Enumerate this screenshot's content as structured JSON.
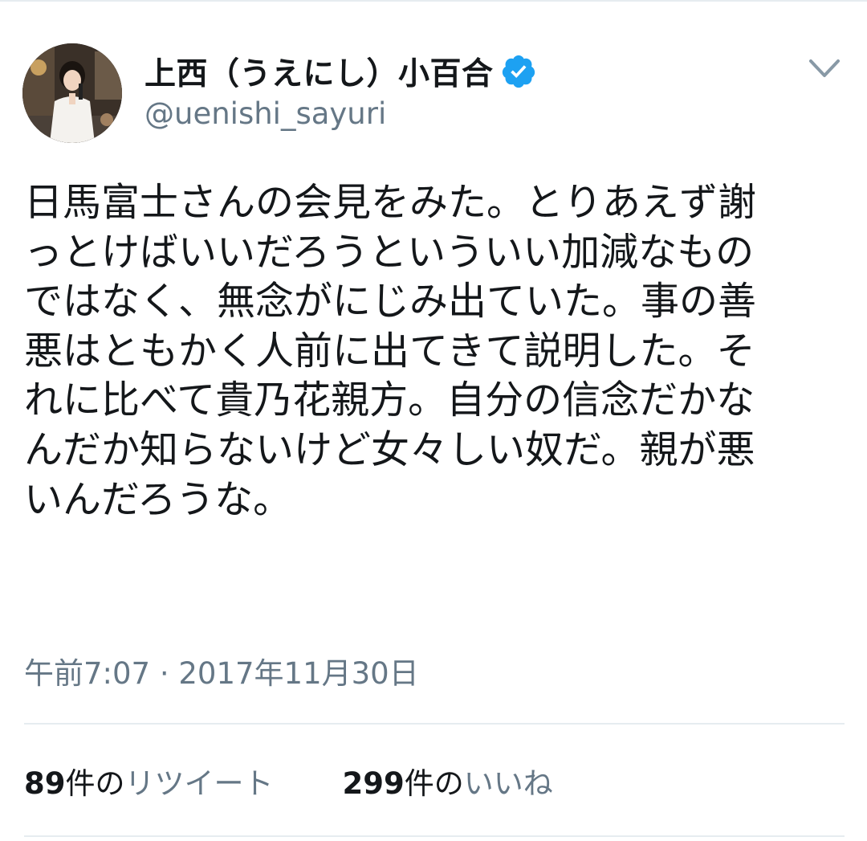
{
  "author": {
    "display_name": "上西（うえにし）小百合",
    "handle": "@uenishi_sayuri",
    "verified_icon": "verified-badge-icon",
    "verified_color": "#1da1f2"
  },
  "tweet": {
    "lines": [
      "日馬富士さんの会見をみた。とりあえず謝",
      "っとけばいいだろうといういい加減なもの",
      "ではなく、無念がにじみ出ていた。事の善",
      "悪はともかく人前に出てきて説明した。そ",
      "れに比べて貴乃花親方。自分の信念だかな",
      "んだか知らないけど女々しい奴だ。親が悪",
      "いんだろうな。"
    ],
    "timestamp": "午前7:07 · 2017年11月30日"
  },
  "stats": {
    "retweets": {
      "count": "89",
      "unit": "件の",
      "label": "リツイート"
    },
    "likes": {
      "count": "299",
      "unit": "件の",
      "label": "いいね"
    }
  },
  "colors": {
    "text": "#14171a",
    "secondary": "#657786",
    "divider": "#e6ecf0"
  }
}
